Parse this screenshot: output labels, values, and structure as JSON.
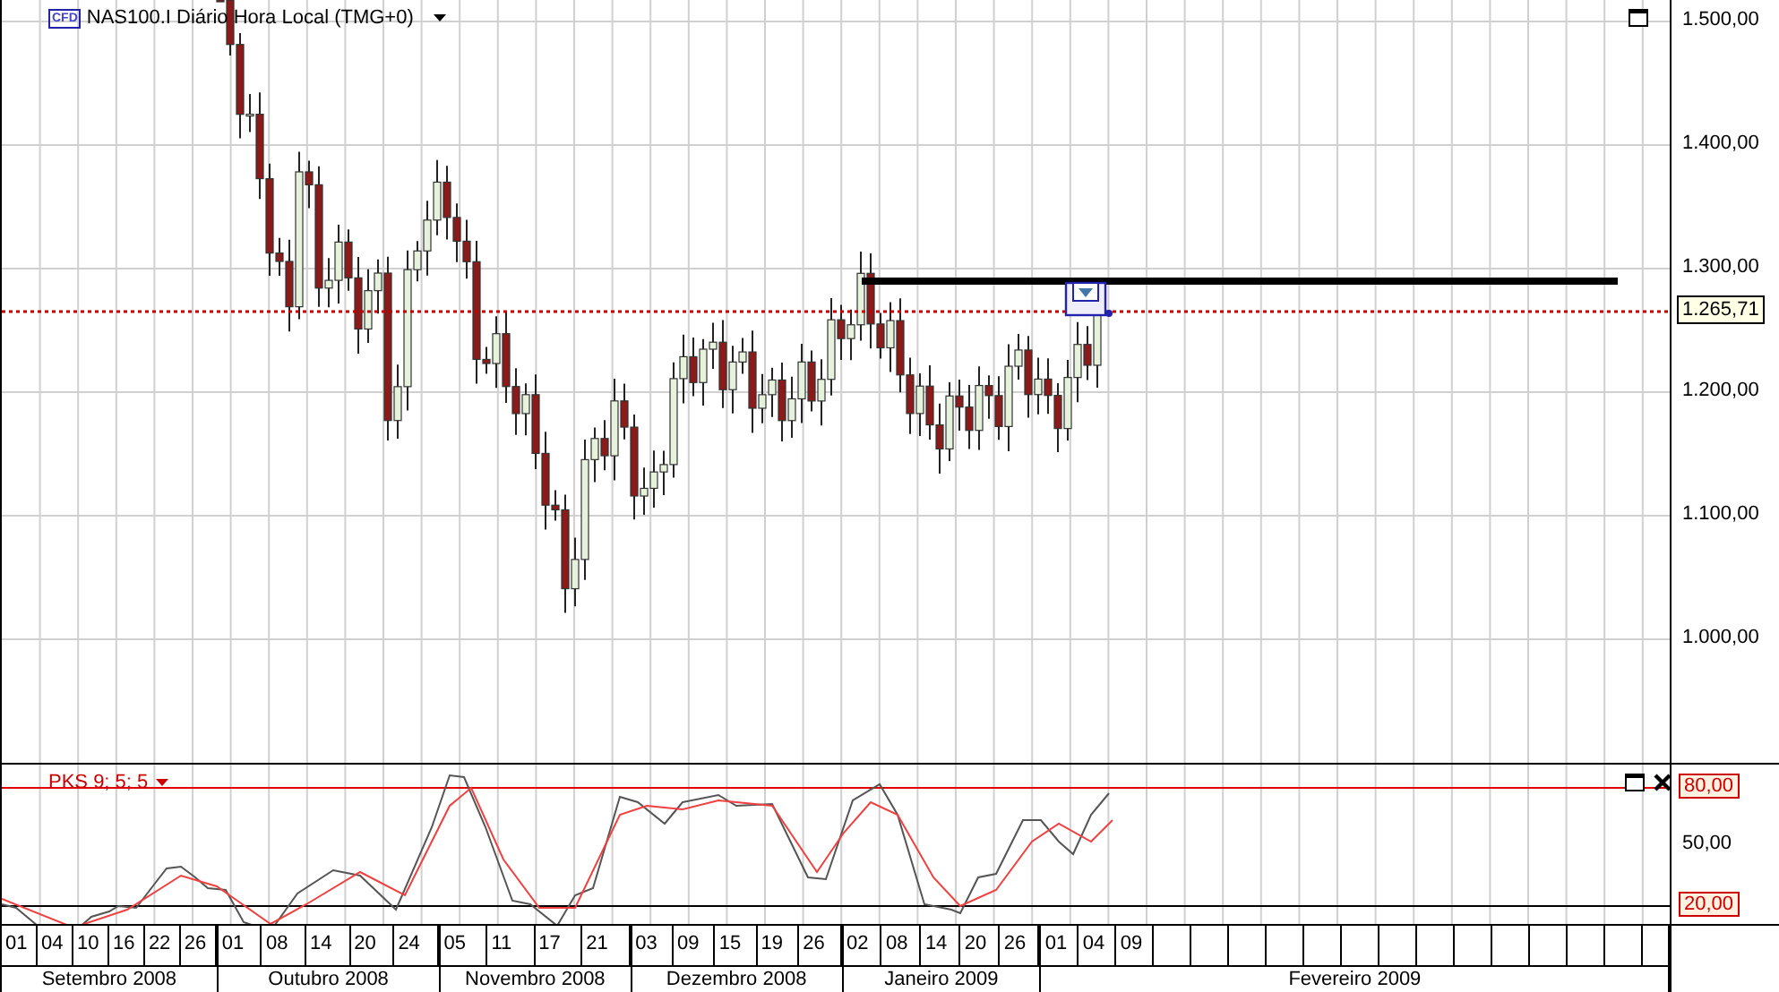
{
  "chart": {
    "badge": "CFD",
    "title": "NAS100.I Diário Hora Local (TMG+0)",
    "price_ticks": [
      "1.500,00",
      "1.400,00",
      "1.300,00",
      "1.200,00",
      "1.100,00",
      "1.000,00"
    ],
    "current_price": "1.265,71"
  },
  "indicator": {
    "label": "PKS 9; 5; 5",
    "axis_ticks": [
      {
        "label": "80,00",
        "kind": "level"
      },
      {
        "label": "50,00",
        "kind": "tick"
      },
      {
        "label": "20,00",
        "kind": "level"
      }
    ]
  },
  "time_axis": {
    "months": [
      {
        "name": "Setembro 2008",
        "days": [
          "01",
          "04",
          "10",
          "16",
          "22",
          "26"
        ]
      },
      {
        "name": "Outubro 2008",
        "days": [
          "01",
          "08",
          "14",
          "20",
          "24"
        ]
      },
      {
        "name": "Novembro 2008",
        "days": [
          "05",
          "11",
          "17",
          "21"
        ]
      },
      {
        "name": "Dezembro 2008",
        "days": [
          "03",
          "09",
          "15",
          "19",
          "26"
        ]
      },
      {
        "name": "Janeiro 2009",
        "days": [
          "02",
          "08",
          "14",
          "20",
          "26"
        ]
      },
      {
        "name": "Fevereiro 2009",
        "days": [
          "01",
          "04",
          "09"
        ]
      }
    ]
  }
}
